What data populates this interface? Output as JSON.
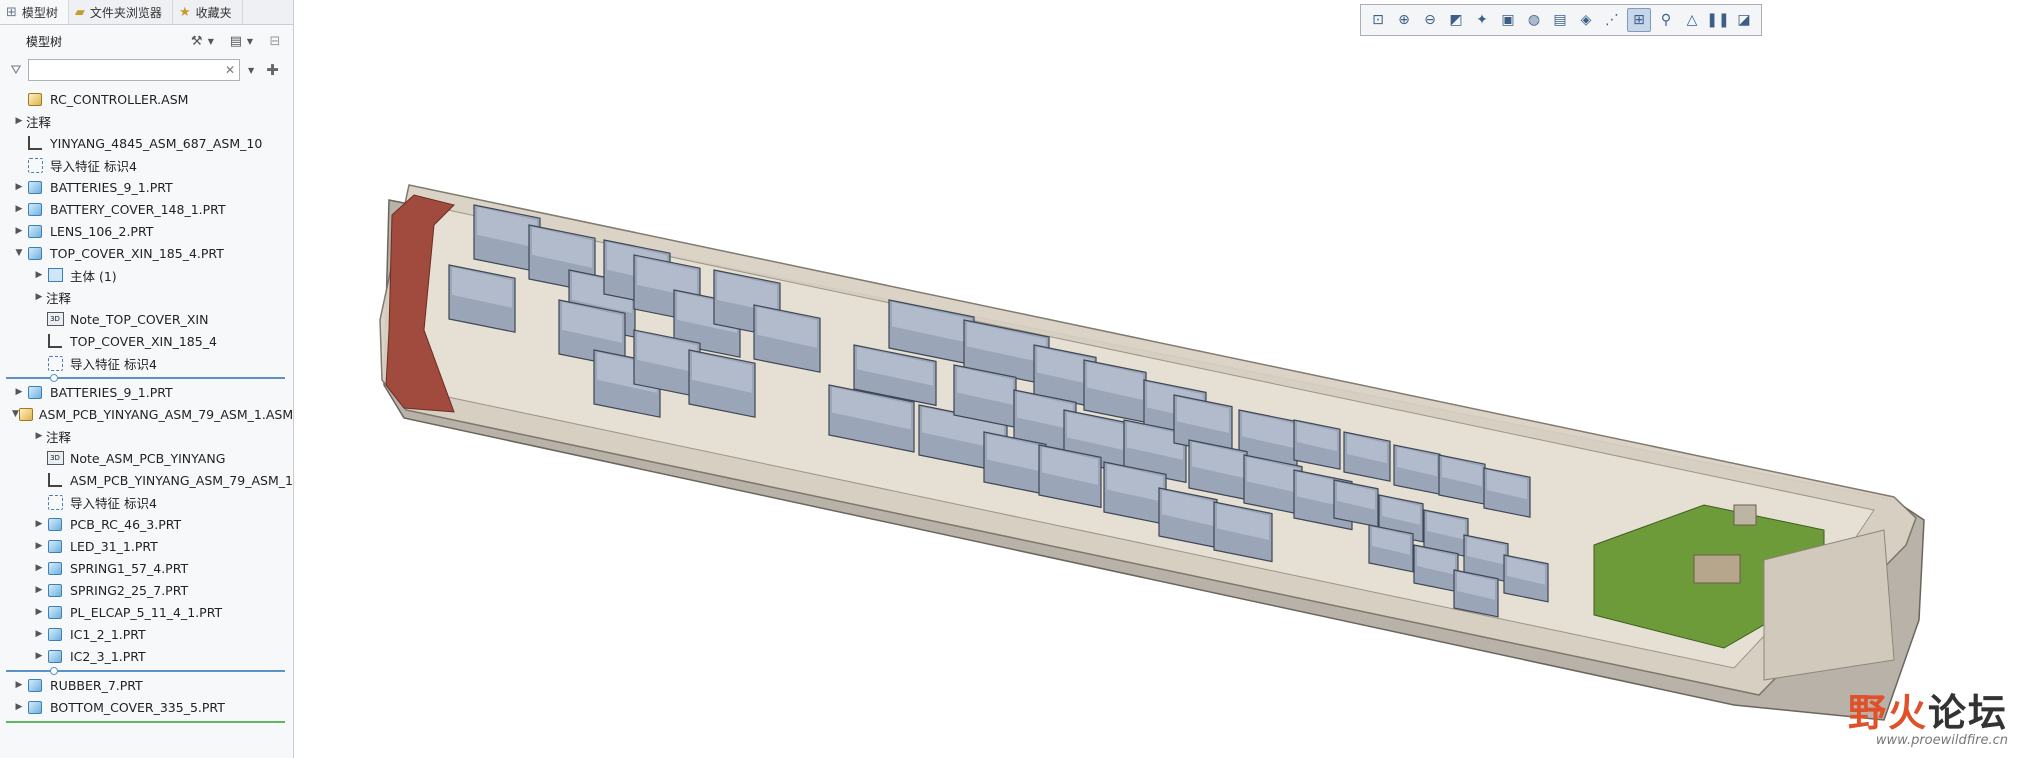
{
  "tabs": [
    {
      "label": "模型树",
      "icon": "tree-icon"
    },
    {
      "label": "文件夹浏览器",
      "icon": "folder-icon"
    },
    {
      "label": "收藏夹",
      "icon": "star-icon"
    }
  ],
  "header": {
    "title": "模型树"
  },
  "search": {
    "placeholder": "",
    "value": ""
  },
  "tree": [
    {
      "label": "RC_CONTROLLER.ASM",
      "level": 0,
      "exp": "",
      "icon": "asm",
      "name": "tree-root-asm"
    },
    {
      "label": "注释",
      "level": 0,
      "exp": "▶",
      "icon": "",
      "name": "tree-item-annotations"
    },
    {
      "label": "YINYANG_4845_ASM_687_ASM_10",
      "level": 0,
      "exp": "",
      "icon": "csys",
      "name": "tree-item-csys"
    },
    {
      "label": "导入特征 标识4",
      "level": 0,
      "exp": "",
      "icon": "imp",
      "name": "tree-item-import-feature"
    },
    {
      "label": "BATTERIES_9_1.PRT",
      "level": 0,
      "exp": "▶",
      "icon": "part",
      "name": "tree-item-part"
    },
    {
      "label": "BATTERY_COVER_148_1.PRT",
      "level": 0,
      "exp": "▶",
      "icon": "part",
      "name": "tree-item-part"
    },
    {
      "label": "LENS_106_2.PRT",
      "level": 0,
      "exp": "▶",
      "icon": "part",
      "name": "tree-item-part"
    },
    {
      "label": "TOP_COVER_XIN_185_4.PRT",
      "level": 0,
      "exp": "▼",
      "icon": "part",
      "name": "tree-item-part-expanded"
    },
    {
      "label": "主体 (1)",
      "level": 1,
      "exp": "▶",
      "icon": "body",
      "name": "tree-item-body"
    },
    {
      "label": "注释",
      "level": 1,
      "exp": "▶",
      "icon": "",
      "name": "tree-item-annotations"
    },
    {
      "label": "Note_TOP_COVER_XIN",
      "level": 1,
      "exp": "",
      "icon": "note",
      "name": "tree-item-note"
    },
    {
      "label": "TOP_COVER_XIN_185_4",
      "level": 1,
      "exp": "",
      "icon": "csys",
      "name": "tree-item-csys"
    },
    {
      "label": "导入特征 标识4",
      "level": 1,
      "exp": "",
      "icon": "imp",
      "name": "tree-item-import-feature"
    },
    {
      "sep": "blue"
    },
    {
      "label": "BATTERIES_9_1.PRT",
      "level": 0,
      "exp": "▶",
      "icon": "part",
      "name": "tree-item-part"
    },
    {
      "label": "ASM_PCB_YINYANG_ASM_79_ASM_1.ASM",
      "level": 0,
      "exp": "▼",
      "icon": "asm",
      "name": "tree-item-subassembly"
    },
    {
      "label": "注释",
      "level": 1,
      "exp": "▶",
      "icon": "",
      "name": "tree-item-annotations"
    },
    {
      "label": "Note_ASM_PCB_YINYANG",
      "level": 1,
      "exp": "",
      "icon": "note",
      "name": "tree-item-note"
    },
    {
      "label": "ASM_PCB_YINYANG_ASM_79_ASM_1",
      "level": 1,
      "exp": "",
      "icon": "csys",
      "name": "tree-item-csys"
    },
    {
      "label": "导入特征 标识4",
      "level": 1,
      "exp": "",
      "icon": "imp",
      "name": "tree-item-import-feature"
    },
    {
      "label": "PCB_RC_46_3.PRT",
      "level": 1,
      "exp": "▶",
      "icon": "part",
      "name": "tree-item-part"
    },
    {
      "label": "LED_31_1.PRT",
      "level": 1,
      "exp": "▶",
      "icon": "part",
      "name": "tree-item-part"
    },
    {
      "label": "SPRING1_57_4.PRT",
      "level": 1,
      "exp": "▶",
      "icon": "part",
      "name": "tree-item-part"
    },
    {
      "label": "SPRING2_25_7.PRT",
      "level": 1,
      "exp": "▶",
      "icon": "part",
      "name": "tree-item-part"
    },
    {
      "label": "PL_ELCAP_5_11_4_1.PRT",
      "level": 1,
      "exp": "▶",
      "icon": "part",
      "name": "tree-item-part"
    },
    {
      "label": "IC1_2_1.PRT",
      "level": 1,
      "exp": "▶",
      "icon": "part",
      "name": "tree-item-part"
    },
    {
      "label": "IC2_3_1.PRT",
      "level": 1,
      "exp": "▶",
      "icon": "part",
      "name": "tree-item-part"
    },
    {
      "sep": "blue"
    },
    {
      "label": "RUBBER_7.PRT",
      "level": 0,
      "exp": "▶",
      "icon": "part",
      "name": "tree-item-part"
    },
    {
      "label": "BOTTOM_COVER_335_5.PRT",
      "level": 0,
      "exp": "▶",
      "icon": "part",
      "name": "tree-item-part"
    },
    {
      "sep": "green"
    }
  ],
  "view_toolbar": [
    {
      "icon": "refit-icon",
      "glyph": "⊡"
    },
    {
      "icon": "zoom-in-icon",
      "glyph": "⊕"
    },
    {
      "icon": "zoom-out-icon",
      "glyph": "⊖"
    },
    {
      "icon": "repaint-icon",
      "glyph": "◩"
    },
    {
      "icon": "spin-center-icon",
      "glyph": "✦"
    },
    {
      "icon": "display-style-icon",
      "glyph": "▣"
    },
    {
      "icon": "saved-orientations-icon",
      "glyph": "◍"
    },
    {
      "icon": "view-manager-icon",
      "glyph": "▤"
    },
    {
      "icon": "perspective-icon",
      "glyph": "◈"
    },
    {
      "icon": "datum-display-icon",
      "glyph": "⋰"
    },
    {
      "icon": "annotation-display-icon",
      "glyph": "⊞",
      "on": true
    },
    {
      "icon": "spin-center-toggle-icon",
      "glyph": "⚲"
    },
    {
      "icon": "warning-display-icon",
      "glyph": "△"
    },
    {
      "icon": "pause-icon",
      "glyph": "❚❚"
    },
    {
      "icon": "sketch-view-icon",
      "glyph": "◪"
    }
  ],
  "watermark": {
    "main_a": "野火",
    "main_b": "论坛",
    "url": "www.proewildfire.cn"
  }
}
